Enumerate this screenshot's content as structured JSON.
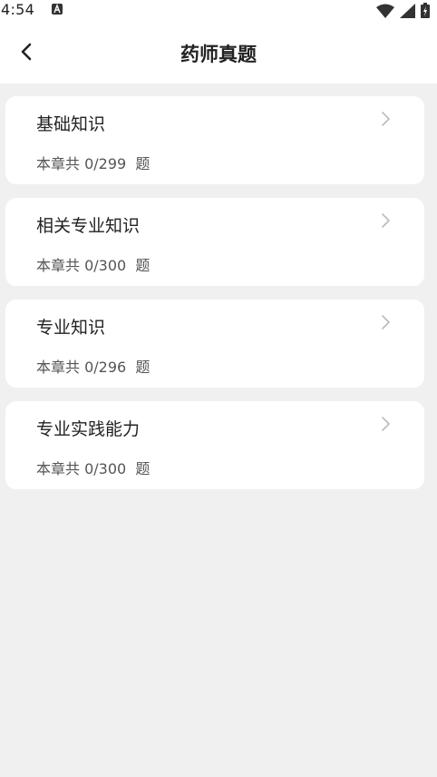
{
  "status_bar": {
    "time": "4:54",
    "notification_icon": "a-icon",
    "wifi_icon": "wifi-icon",
    "signal_icon": "signal-icon",
    "battery_icon": "battery-charging-icon"
  },
  "header": {
    "back_icon": "chevron-left-icon",
    "title": "药师真题"
  },
  "chapters": [
    {
      "title": "基础知识",
      "progress": "本章共 0/299  题"
    },
    {
      "title": "相关专业知识",
      "progress": "本章共 0/300  题"
    },
    {
      "title": "专业知识",
      "progress": "本章共 0/296  题"
    },
    {
      "title": "专业实践能力",
      "progress": "本章共 0/300  题"
    }
  ],
  "colors": {
    "background": "#f0f0f0",
    "card": "#ffffff",
    "text_primary": "#222222",
    "text_secondary": "#555555",
    "chevron": "#bbbbbb"
  }
}
